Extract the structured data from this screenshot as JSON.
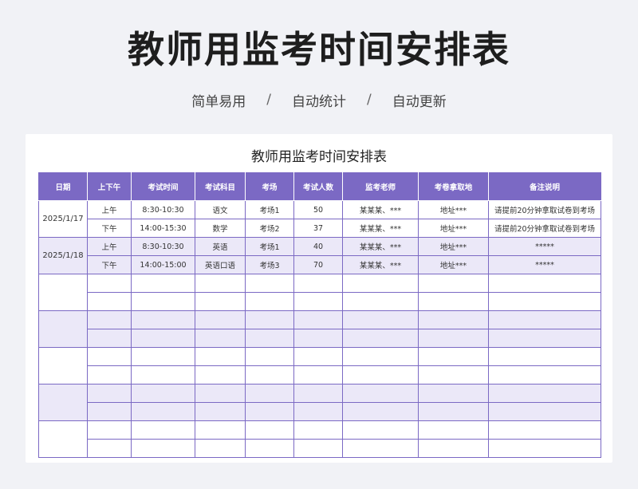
{
  "header": {
    "title": "教师用监考时间安排表",
    "features": [
      "简单易用",
      "自动统计",
      "自动更新"
    ],
    "separator": "/"
  },
  "sheet": {
    "title": "教师用监考时间安排表",
    "columns": [
      "日期",
      "上下午",
      "考试时间",
      "考试科目",
      "考场",
      "考试人数",
      "监考老师",
      "考卷拿取地",
      "备注说明"
    ],
    "groups": [
      {
        "date": "2025/1/17",
        "rows": [
          [
            "上午",
            "8:30-10:30",
            "语文",
            "考场1",
            "50",
            "某某某、***",
            "地址***",
            "请提前20分钟拿取试卷到考场"
          ],
          [
            "下午",
            "14:00-15:30",
            "数学",
            "考场2",
            "37",
            "某某某、***",
            "地址***",
            "请提前20分钟拿取试卷到考场"
          ]
        ]
      },
      {
        "date": "2025/1/18",
        "rows": [
          [
            "上午",
            "8:30-10:30",
            "英语",
            "考场1",
            "40",
            "某某某、***",
            "地址***",
            "*****"
          ],
          [
            "下午",
            "14:00-15:00",
            "英语口语",
            "考场3",
            "70",
            "某某某、***",
            "地址***",
            "*****"
          ]
        ]
      },
      {
        "date": "",
        "rows": [
          [
            "",
            "",
            "",
            "",
            "",
            "",
            "",
            ""
          ],
          [
            "",
            "",
            "",
            "",
            "",
            "",
            "",
            ""
          ]
        ]
      },
      {
        "date": "",
        "rows": [
          [
            "",
            "",
            "",
            "",
            "",
            "",
            "",
            ""
          ],
          [
            "",
            "",
            "",
            "",
            "",
            "",
            "",
            ""
          ]
        ]
      },
      {
        "date": "",
        "rows": [
          [
            "",
            "",
            "",
            "",
            "",
            "",
            "",
            ""
          ],
          [
            "",
            "",
            "",
            "",
            "",
            "",
            "",
            ""
          ]
        ]
      },
      {
        "date": "",
        "rows": [
          [
            "",
            "",
            "",
            "",
            "",
            "",
            "",
            ""
          ],
          [
            "",
            "",
            "",
            "",
            "",
            "",
            "",
            ""
          ]
        ]
      },
      {
        "date": "",
        "rows": [
          [
            "",
            "",
            "",
            "",
            "",
            "",
            "",
            ""
          ],
          [
            "",
            "",
            "",
            "",
            "",
            "",
            "",
            ""
          ]
        ]
      }
    ]
  },
  "colors": {
    "header_bg": "#7b69c4",
    "shade_bg": "#ebe8f8",
    "border": "#7b69c4"
  }
}
